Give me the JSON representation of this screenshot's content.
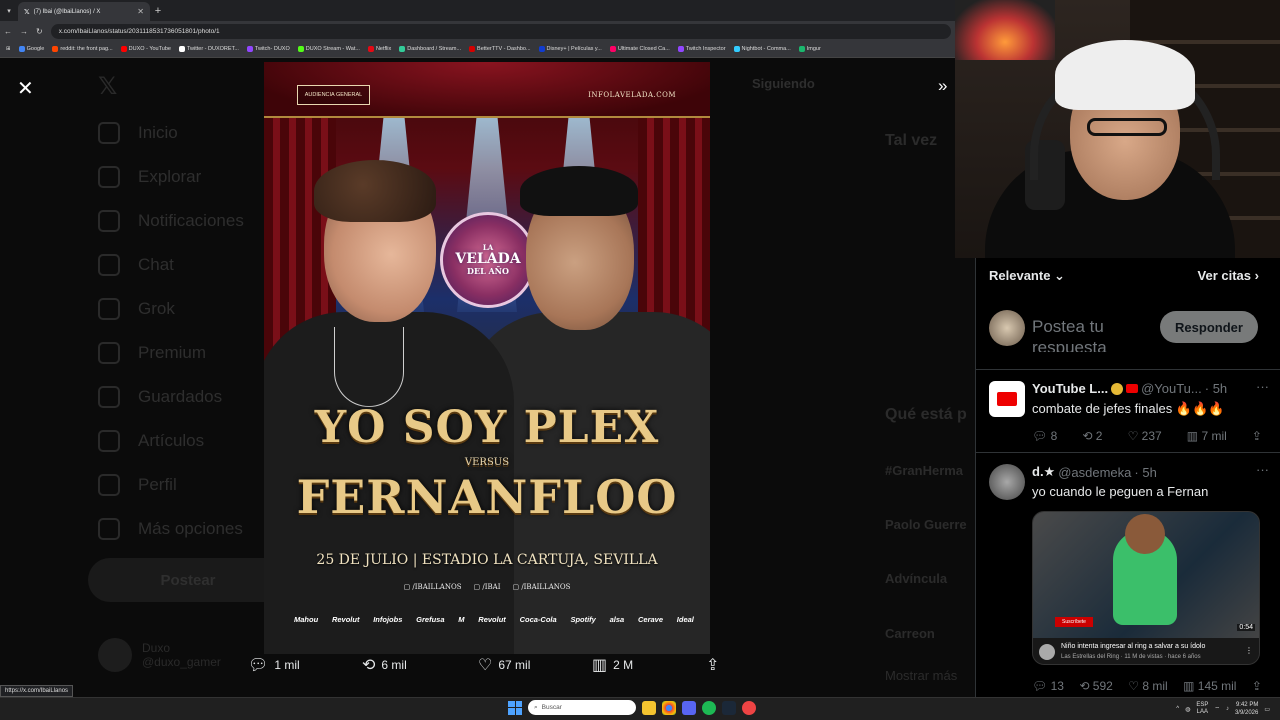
{
  "browser": {
    "tab_title": "(7) Ibai (@IbaiLlanos) / X",
    "url": "x.com/IbaiLlanos/status/2031118531736051801/photo/1",
    "status_url": "https://x.com/IbaiLlanos",
    "bookmarks": [
      "Google",
      "reddit: the front pag...",
      "DUXO - YouTube",
      "Twitter - DUXORET...",
      "Twitch- DUXO",
      "DUXO Stream - Wat...",
      "Netflix",
      "Dashboard / Stream...",
      "BetterTTV - Dashbo...",
      "Disney+ | Películas y...",
      "Ultimate Closed Ca...",
      "Twitch Inspector",
      "Nightbot - Comma...",
      "Imgur"
    ]
  },
  "background_nav": {
    "items": [
      "Inicio",
      "Explorar",
      "Notificaciones",
      "Chat",
      "Grok",
      "Premium",
      "Guardados",
      "Artículos",
      "Perfil",
      "Más opciones"
    ],
    "post_button": "Postear",
    "user_name": "Duxo",
    "user_handle": "@duxo_gamer",
    "following": "Siguiendo",
    "right_texts": [
      "Tal vez",
      "Qué está p",
      "#GranHerma",
      "Paolo Guerre",
      "Advíncula",
      "Carreon",
      "Mostrar más"
    ]
  },
  "poster": {
    "badge": "AUDIENCIA GENERAL",
    "site": "INFOLAVELADA.COM",
    "logo_line1": "LA",
    "logo_line2": "VELADA",
    "logo_line3": "DEL AÑO",
    "title1": "YO SOY PLEX",
    "versus": "VERSUS",
    "title2": "FERNANFLOO",
    "date": "25 DE JULIO | ESTADIO LA CARTUJA, SEVILLA",
    "socials": [
      "/IBAILLANOS",
      "/IBAI",
      "/IBAILLANOS"
    ],
    "sponsors": [
      "Mahou",
      "Revolut",
      "Infojobs",
      "Grefusa",
      "M",
      "Revolut",
      "Coca-Cola",
      "Spotify",
      "alsa",
      "Cerave",
      "Ideal"
    ]
  },
  "media_actions": {
    "replies": "1 mil",
    "reposts": "6 mil",
    "likes": "67 mil",
    "views": "2 M"
  },
  "replies_panel": {
    "sort_label": "Relevante",
    "quotes_label": "Ver citas",
    "composer_placeholder": "Postea tu respuesta",
    "reply_button": "Responder",
    "tweets": [
      {
        "name": "YouTube L...",
        "handle": "@YouTu...",
        "time": "· 5h",
        "text": "combate de jefes finales 🔥🔥🔥",
        "replies": "8",
        "reposts": "2",
        "likes": "237",
        "views": "7 mil"
      },
      {
        "name": "d.★",
        "handle": "@asdemeka",
        "time": "· 5h",
        "text": "yo cuando le peguen a Fernan",
        "video_title": "Niño intenta ingresar al ring a salvar a su ídolo",
        "video_meta": "Las Estrellas del Ring · 11 M de vistas · hace 6 años",
        "video_duration": "0:54",
        "subscribe": "Suscríbete",
        "replies": "13",
        "reposts": "592",
        "likes": "8 mil",
        "views": "145 mil"
      }
    ]
  },
  "taskbar": {
    "search_placeholder": "Buscar",
    "lang": "ESP",
    "lang_sub": "LAA",
    "time": "9:42 PM",
    "date": "3/9/2026"
  },
  "colors": {
    "accent_gold": "#e8c987",
    "x_text": "#e7e9ea",
    "x_muted": "#71767b",
    "youtube_red": "#e00"
  }
}
